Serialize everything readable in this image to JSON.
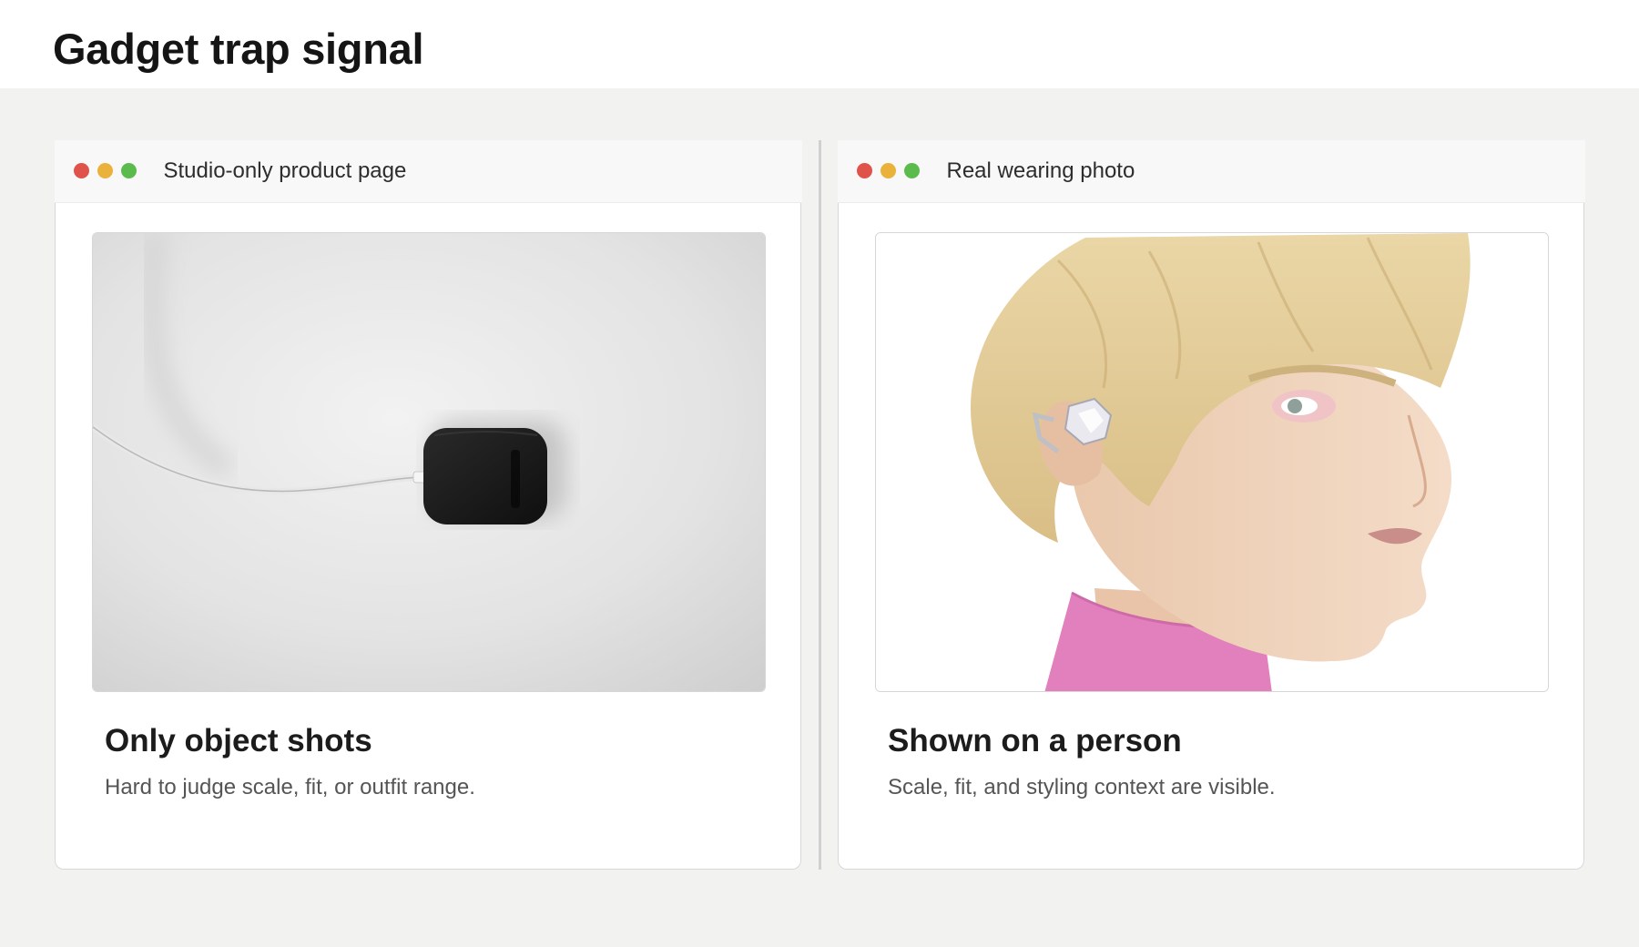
{
  "page": {
    "title": "Gadget trap signal"
  },
  "panels": [
    {
      "window_title": "Studio-only product page",
      "image_alt": "Black earbud charging case with white cable on a white surface",
      "heading": "Only object shots",
      "description": "Hard to judge scale, fit, or outfit range."
    },
    {
      "window_title": "Real wearing photo",
      "image_alt": "Blonde person wearing a silver crystal ear-cuff earbud",
      "heading": "Shown on a person",
      "description": "Scale, fit, and styling context are visible."
    }
  ],
  "colors": {
    "dot_red": "#e0534b",
    "dot_yellow": "#eab23a",
    "dot_green": "#5cbb4d",
    "background": "#f2f2f1"
  }
}
